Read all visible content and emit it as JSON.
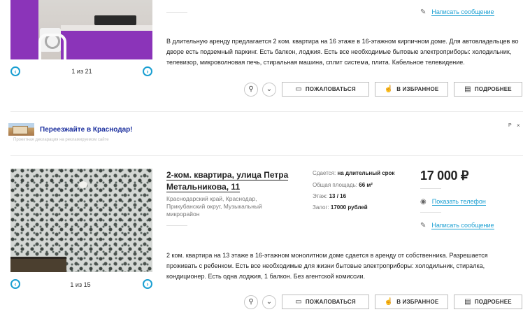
{
  "listing1": {
    "contact_link": "Написать сообщение",
    "pager": {
      "text": "1 из 21"
    },
    "description": "В длительную аренду предлагается 2 ком. квартира на 16 этаже в 16-этажном кирпичном доме. Для автовладельцев во дворе есть подземный паркинг. Есть балкон, лоджия. Есть все необходимые бытовые электроприборы: холодильник, телевизор, микроволновая печь, стиральная машина, сплит система, плита. Кабельное телевидение.",
    "actions": {
      "report": "ПОЖАЛОВАТЬСЯ",
      "favorite": "В ИЗБРАННОЕ",
      "details": "ПОДРОБНЕЕ"
    }
  },
  "ad": {
    "title": "Переезжайте в Краснодар!",
    "note": "Проектная декларация на рекламируемом сайте",
    "mark": "Р",
    "close": "×"
  },
  "listing2": {
    "title": "2-ком. квартира, улица Петра Метальникова, 11",
    "address": "Краснодарский край, Краснодар, Прикубанский округ, Музыкальный микрорайон",
    "facts": {
      "rent_label": "Сдается:",
      "rent_value": "на длительный срок",
      "area_label": "Общая площадь:",
      "area_value": "66 м²",
      "floor_label": "Этаж:",
      "floor_value": "13 / 16",
      "deposit_label": "Залог:",
      "deposit_value": "17000 рублей"
    },
    "price": "17 000 ₽",
    "show_phone": "Показать телефон",
    "contact_link": "Написать сообщение",
    "pager": {
      "text": "1 из 15"
    },
    "description": "2 ком. квартира на 13 этаже в 16-этажном монолитном доме сдается в аренду от собственника. Разрешается проживать с ребенком. Есть все необходимые для жизни бытовые электроприборы: холодильник, стиралка, кондиционер. Есть одна лоджия, 1 балкон. Без агентской комиссии.",
    "actions": {
      "report": "ПОЖАЛОВАТЬСЯ",
      "favorite": "В ИЗБРАННОЕ",
      "details": "ПОДРОБНЕЕ"
    }
  },
  "colors": {
    "accent": "#1a9fd2",
    "ad_title": "#1b2f9e",
    "kitchen_purple": "#8b34b9"
  },
  "icons": [
    "map-pin-icon",
    "chevron-down-icon",
    "flag-icon",
    "thumbs-up-icon",
    "document-icon",
    "pencil-icon",
    "eye-icon",
    "arrow-left-icon",
    "arrow-right-icon"
  ]
}
